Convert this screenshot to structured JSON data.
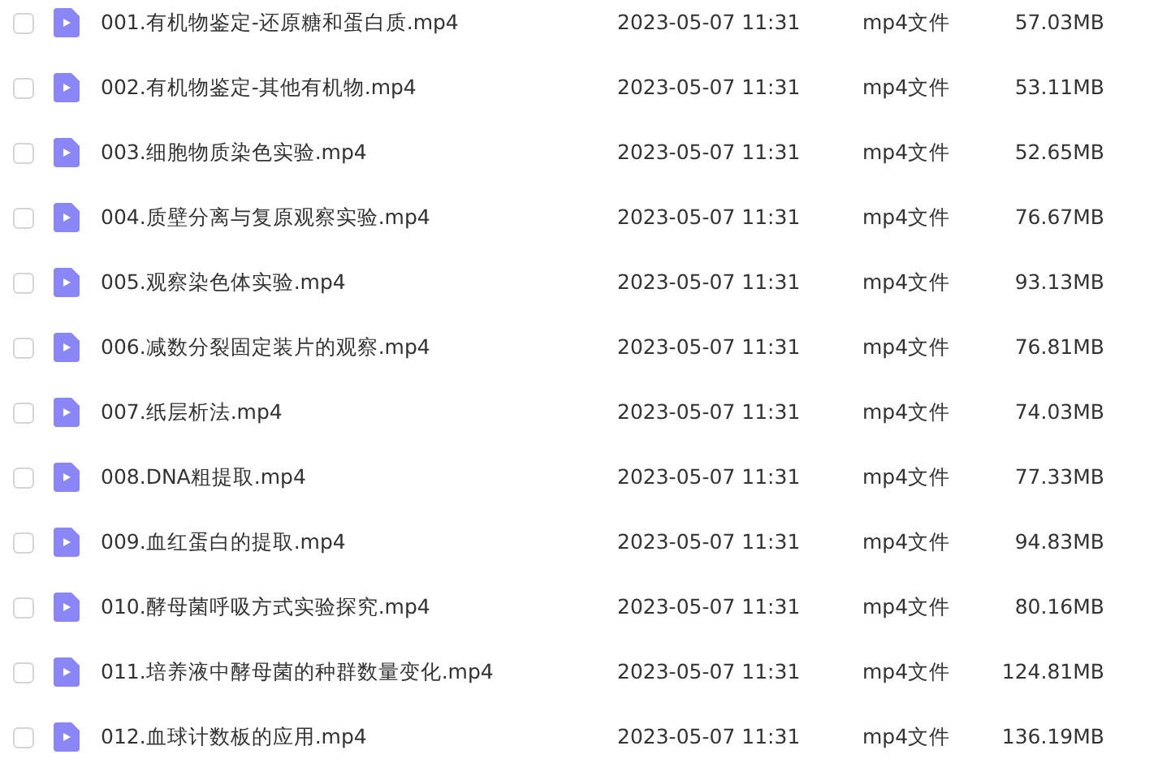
{
  "files": [
    {
      "name": "001.有机物鉴定-还原糖和蛋白质.mp4",
      "modified": "2023-05-07 11:31",
      "type": "mp4文件",
      "size": "57.03MB",
      "checked": false
    },
    {
      "name": "002.有机物鉴定-其他有机物.mp4",
      "modified": "2023-05-07 11:31",
      "type": "mp4文件",
      "size": "53.11MB",
      "checked": false
    },
    {
      "name": "003.细胞物质染色实验.mp4",
      "modified": "2023-05-07 11:31",
      "type": "mp4文件",
      "size": "52.65MB",
      "checked": false
    },
    {
      "name": "004.质壁分离与复原观察实验.mp4",
      "modified": "2023-05-07 11:31",
      "type": "mp4文件",
      "size": "76.67MB",
      "checked": false
    },
    {
      "name": "005.观察染色体实验.mp4",
      "modified": "2023-05-07 11:31",
      "type": "mp4文件",
      "size": "93.13MB",
      "checked": false
    },
    {
      "name": "006.减数分裂固定装片的观察.mp4",
      "modified": "2023-05-07 11:31",
      "type": "mp4文件",
      "size": "76.81MB",
      "checked": false
    },
    {
      "name": "007.纸层析法.mp4",
      "modified": "2023-05-07 11:31",
      "type": "mp4文件",
      "size": "74.03MB",
      "checked": false
    },
    {
      "name": "008.DNA粗提取.mp4",
      "modified": "2023-05-07 11:31",
      "type": "mp4文件",
      "size": "77.33MB",
      "checked": false
    },
    {
      "name": "009.血红蛋白的提取.mp4",
      "modified": "2023-05-07 11:31",
      "type": "mp4文件",
      "size": "94.83MB",
      "checked": false
    },
    {
      "name": "010.酵母菌呼吸方式实验探究.mp4",
      "modified": "2023-05-07 11:31",
      "type": "mp4文件",
      "size": "80.16MB",
      "checked": false
    },
    {
      "name": "011.培养液中酵母菌的种群数量变化.mp4",
      "modified": "2023-05-07 11:31",
      "type": "mp4文件",
      "size": "124.81MB",
      "checked": false
    },
    {
      "name": "012.血球计数板的应用.mp4",
      "modified": "2023-05-07 11:31",
      "type": "mp4文件",
      "size": "136.19MB",
      "checked": false
    }
  ]
}
